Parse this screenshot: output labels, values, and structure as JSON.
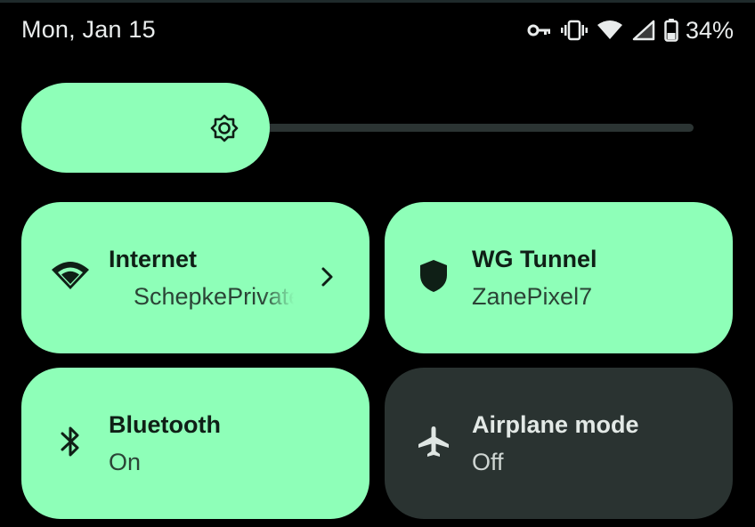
{
  "status_bar": {
    "date": "Mon, Jan 15",
    "battery_percent": "34%",
    "icons": [
      "vpn-key-icon",
      "vibrate-icon",
      "wifi-icon",
      "cell-signal-icon",
      "battery-icon"
    ]
  },
  "brightness": {
    "level": 0.36,
    "icon": "brightness-icon"
  },
  "tiles": [
    {
      "title": "Internet",
      "subtitle": "SchepkePrivate",
      "state": "on",
      "icon": "wifi-icon",
      "has_chevron": true
    },
    {
      "title": "WG Tunnel",
      "subtitle": "ZanePixel7",
      "state": "on",
      "icon": "shield-icon",
      "has_chevron": false
    },
    {
      "title": "Bluetooth",
      "subtitle": "On",
      "state": "on",
      "icon": "bluetooth-icon",
      "has_chevron": false
    },
    {
      "title": "Airplane mode",
      "subtitle": "Off",
      "state": "off",
      "icon": "airplane-icon",
      "has_chevron": false
    }
  ],
  "colors": {
    "tile_on": "#8effb8",
    "tile_off": "#2a3331",
    "background": "#000000"
  }
}
